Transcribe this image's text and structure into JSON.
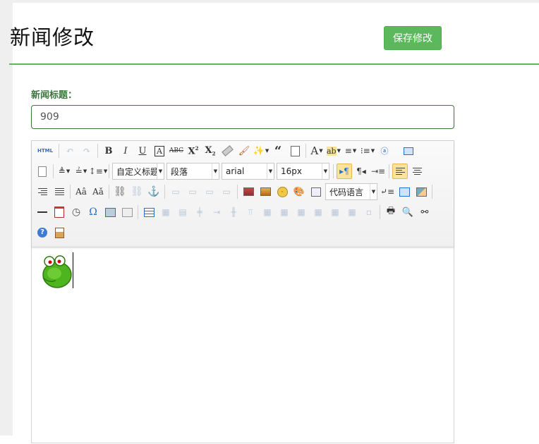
{
  "header": {
    "title": "新闻修改",
    "save_label": "保存修改"
  },
  "form": {
    "title_label": "新闻标题：",
    "title_value": "909"
  },
  "toolbar": {
    "html_label": "HTML",
    "selects": {
      "custom_title": "自定义标题",
      "paragraph": "段落",
      "font_family": "arial",
      "font_size": "16px",
      "code_language": "代码语言"
    }
  },
  "colors": {
    "accent": "#5cb85c",
    "label_green": "#3c763d",
    "active_button": "#fbe39b"
  },
  "editor_content": {
    "emoticon": "green-frog-emoticon"
  }
}
